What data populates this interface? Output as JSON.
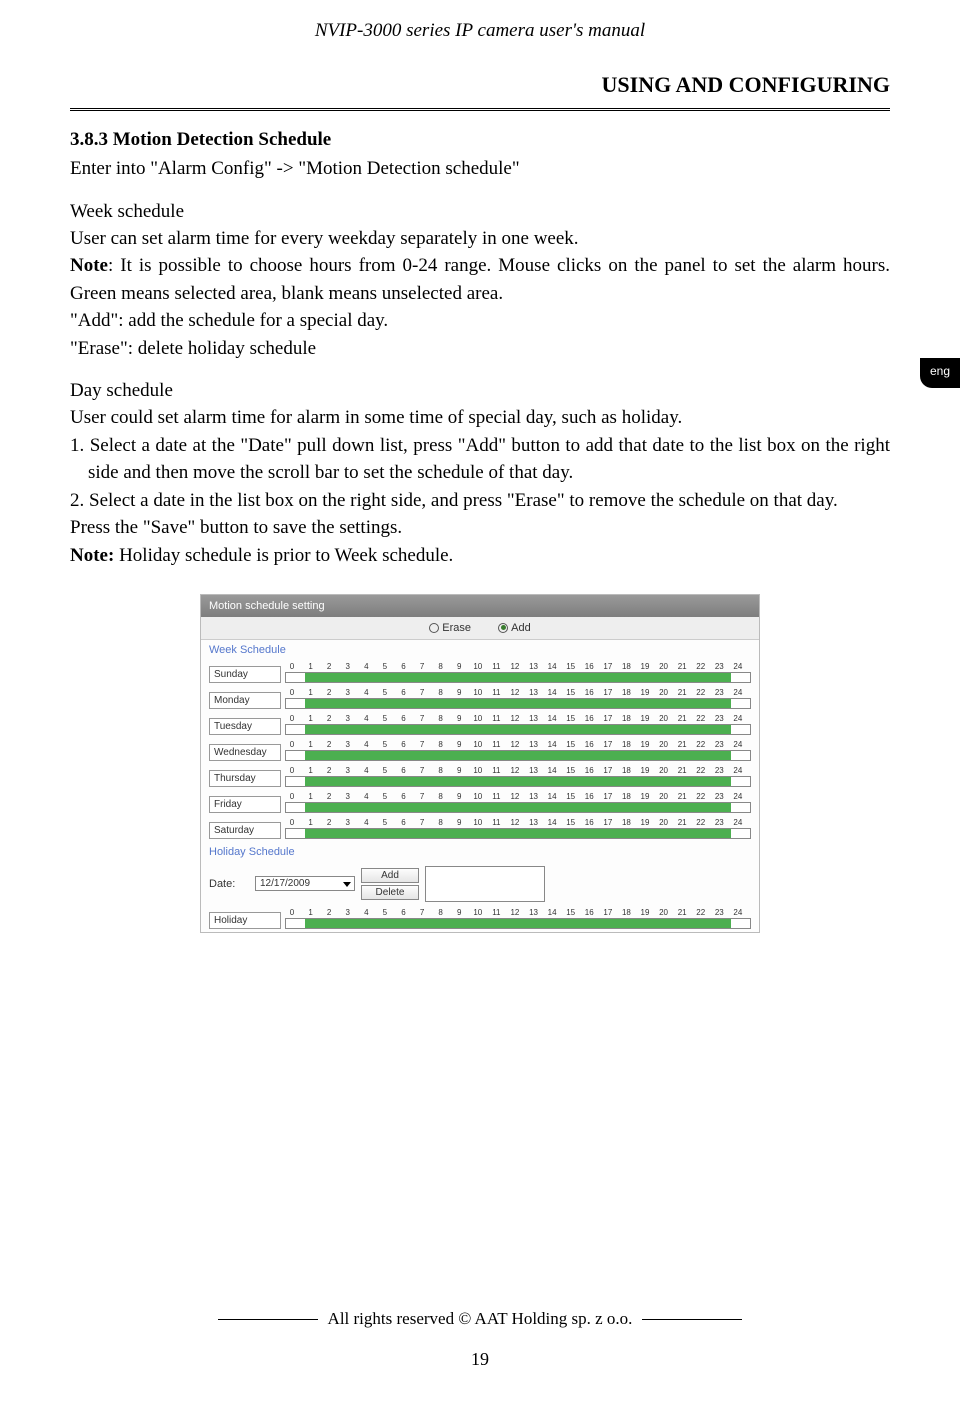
{
  "header": {
    "manual_title": "NVIP-3000 series IP camera user's manual"
  },
  "page_title": "USING AND CONFIGURING",
  "lang_tab": "eng",
  "section": {
    "num_title": "3.8.3 Motion Detection Schedule",
    "intro": "Enter into \"Alarm Config\" ->  \"Motion Detection schedule\"",
    "week_h": "Week schedule",
    "week_p1": "User can set alarm time for every weekday separately in one week.",
    "note_label": "Note",
    "week_p2a": ": It is possible to choose hours from 0-24 range. Mouse clicks on the panel to set the alarm hours. Green means selected area, blank means unselected area.",
    "add_line": "\"Add\":    add the schedule for a special day.",
    "erase_line": "\"Erase\":  delete holiday schedule",
    "day_h": "Day schedule",
    "day_p1": "User could set alarm time for alarm in some time of special day, such as holiday.",
    "li1": "1. Select a date at the \"Date\" pull down list, press \"Add\" button to add that date to the list box on the right side and then move the scroll bar to set the schedule of that day.",
    "li2": "2. Select a date in the list box on the right side, and press \"Erase\" to remove the schedule on that day.",
    "save_line": "Press the \"Save\" button to save the settings.",
    "note2_label": "Note:",
    "note2_text": " Holiday schedule is prior to Week schedule."
  },
  "screenshot": {
    "title": "Motion schedule setting",
    "radio_erase": "Erase",
    "radio_add": "Add",
    "week_label": "Week Schedule",
    "ticks": [
      "0",
      "1",
      "2",
      "3",
      "4",
      "5",
      "6",
      "7",
      "8",
      "9",
      "10",
      "11",
      "12",
      "13",
      "14",
      "15",
      "16",
      "17",
      "18",
      "19",
      "20",
      "21",
      "22",
      "23",
      "24"
    ],
    "days": [
      "Sunday",
      "Monday",
      "Tuesday",
      "Wednesday",
      "Thursday",
      "Friday",
      "Saturday"
    ],
    "holiday_label": "Holiday Schedule",
    "date_label": "Date:",
    "date_value": "12/17/2009",
    "btn_add": "Add",
    "btn_delete": "Delete",
    "holiday_day": "Holiday"
  },
  "footer": {
    "rights": "All rights reserved © AAT Holding sp. z o.o.",
    "page_num": "19"
  }
}
